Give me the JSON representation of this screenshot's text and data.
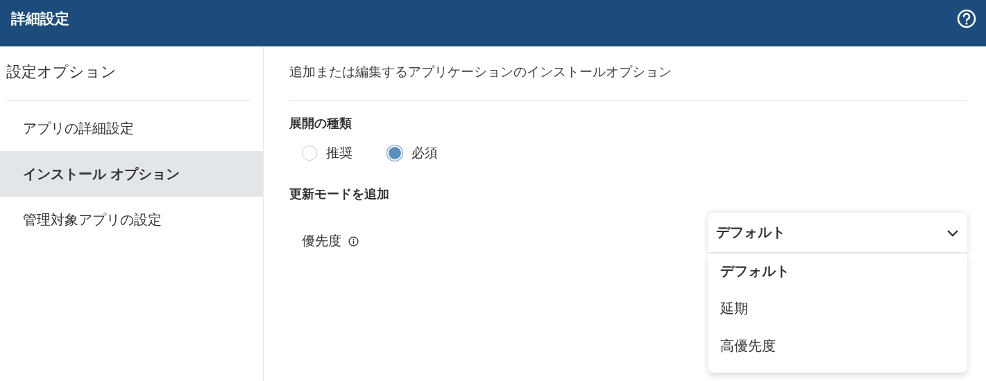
{
  "header": {
    "title": "詳細設定"
  },
  "sidebar": {
    "heading": "設定オプション",
    "items": [
      {
        "label": "アプリの詳細設定",
        "selected": false
      },
      {
        "label": "インストール オプション",
        "selected": true
      },
      {
        "label": "管理対象アプリの設定",
        "selected": false
      }
    ]
  },
  "main": {
    "description": "追加または編集するアプリケーションのインストールオプション",
    "deployment": {
      "heading": "展開の種類",
      "options": [
        {
          "label": "推奨",
          "selected": false
        },
        {
          "label": "必須",
          "selected": true
        }
      ]
    },
    "update_mode": {
      "heading": "更新モードを追加",
      "priority": {
        "label": "優先度",
        "value": "デフォルト",
        "expanded": true,
        "options": [
          {
            "label": "デフォルト",
            "selected": true
          },
          {
            "label": "延期",
            "selected": false
          },
          {
            "label": "高優先度",
            "selected": false
          }
        ]
      }
    }
  }
}
